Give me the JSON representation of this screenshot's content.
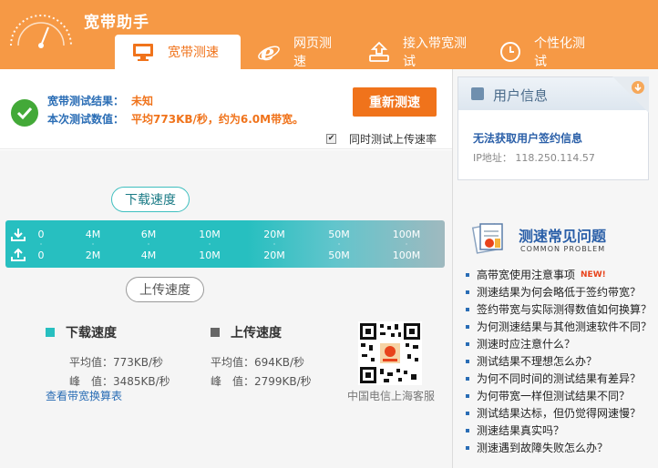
{
  "app": {
    "title": "宽带助手"
  },
  "tabs": [
    {
      "label": "宽带测速",
      "icon": "monitor-icon"
    },
    {
      "label": "网页测速",
      "icon": "ie-icon"
    },
    {
      "label": "接入带宽测试",
      "icon": "upload-box-icon"
    },
    {
      "label": "个性化测试",
      "icon": "clock-icon"
    }
  ],
  "result": {
    "result_label": "宽带测试结果：",
    "result_value": "未知",
    "value_label": "本次测试数值：",
    "value_text": "平均773KB/秒，约为6.0M带宽。",
    "retest_button": "重新测速",
    "upload_checkbox_label": "同时测试上传速率",
    "upload_checked": true
  },
  "gauge": {
    "download_bubble": "下载速度",
    "upload_bubble": "上传速度",
    "download_ticks": [
      "0",
      "4M",
      "6M",
      "10M",
      "20M",
      "50M",
      "100M"
    ],
    "upload_ticks": [
      "0",
      "2M",
      "4M",
      "10M",
      "20M",
      "50M",
      "100M"
    ]
  },
  "stats": {
    "download": {
      "title": "下载速度",
      "avg": "平均值：773KB/秒",
      "peak": "峰　值：3485KB/秒",
      "color": "#27bfc0"
    },
    "upload": {
      "title": "上传速度",
      "avg": "平均值：694KB/秒",
      "peak": "峰　值：2799KB/秒",
      "color": "#666666"
    },
    "table_link": "查看带宽换算表",
    "qr_caption": "中国电信上海客服"
  },
  "user": {
    "title": "用户信息",
    "message": "无法获取用户签约信息",
    "ip": "IP地址： 118.250.114.57"
  },
  "faq": {
    "title": "测速常见问题",
    "subtitle": "COMMON PROBLEM",
    "items": [
      {
        "text": "高带宽使用注意事项",
        "badge": "NEW!"
      },
      {
        "text": "测速结果为何会略低于签约带宽？"
      },
      {
        "text": "签约带宽与实际测得数值如何换算？"
      },
      {
        "text": "为何测速结果与其他测速软件不同？"
      },
      {
        "text": "测速时应注意什么？"
      },
      {
        "text": "测试结果不理想怎么办？"
      },
      {
        "text": "为何不同时间的测试结果有差异？"
      },
      {
        "text": "为何带宽一样但测试结果不同？"
      },
      {
        "text": "测试结果达标，但仍觉得网速慢？"
      },
      {
        "text": "测速结果真实吗？"
      },
      {
        "text": "测速遇到故障失败怎么办？"
      }
    ]
  }
}
